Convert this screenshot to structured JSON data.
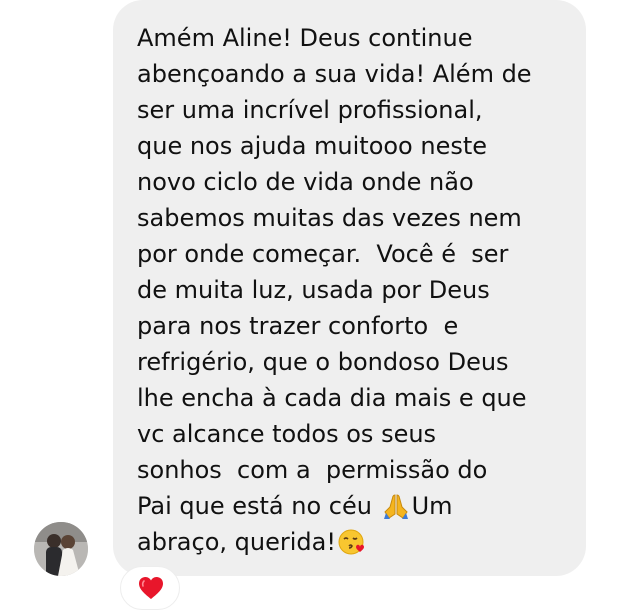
{
  "message": {
    "lines": [
      "Amém Aline! Deus continue",
      "abençoando a sua vida! Além de",
      "ser uma incrível profissional,",
      "que nos ajuda muitooo neste",
      "novo ciclo de vida onde não",
      "sabemos muitas das vezes nem",
      "por onde começar.  Você é  ser",
      "de muita luz, usada por Deus",
      "para nos trazer conforto  e",
      "refrigério, que o bondoso Deus",
      "lhe encha à cada dia mais e que",
      "vc alcance todos os seus",
      "sonhos  com a  permissão do",
      "Pai que está no céu ",
      "abraço, querida!"
    ],
    "line14_after_emoji": "Um",
    "inline_emojis": [
      "praying-hands-icon",
      "kissing-heart-face-icon"
    ]
  },
  "reaction": {
    "icon": "red-heart-icon",
    "color": "#e8162b"
  },
  "colors": {
    "bubble_background": "#efefef",
    "text": "#111111",
    "page_background": "#ffffff"
  }
}
